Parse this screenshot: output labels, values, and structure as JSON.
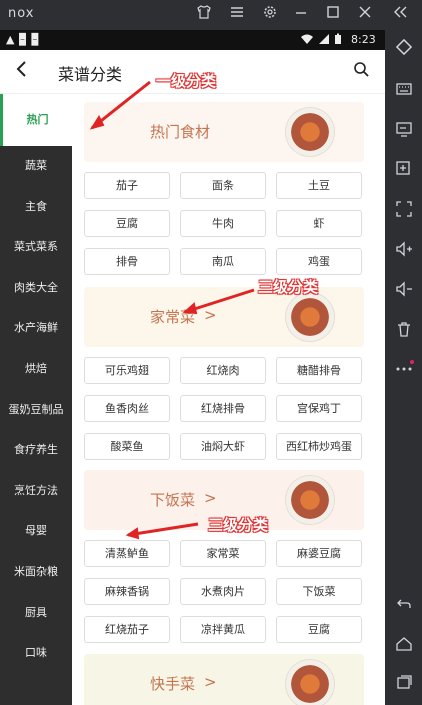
{
  "emulator": {
    "logo": "nox",
    "toolbar_icons": [
      "shirt-icon",
      "menu-icon",
      "gear-icon",
      "minimize-icon",
      "maximize-icon",
      "close-icon",
      "collapse-icon"
    ],
    "side_icons": [
      "diamond-icon",
      "keyboard-icon",
      "screen-icon",
      "add-apk-icon",
      "fullscreen-icon",
      "volume-up-icon",
      "volume-down-icon",
      "trash-icon",
      "more-icon",
      "back-icon",
      "home-icon",
      "recent-apps-icon"
    ]
  },
  "status": {
    "left_text": "▲ 🁢 🁢",
    "time": "8:23"
  },
  "appbar": {
    "title": "菜谱分类",
    "search_icon": "search-icon",
    "back_icon": "back-icon"
  },
  "sidebar": {
    "items": [
      {
        "label": "热门",
        "active": true
      },
      {
        "label": "蔬菜"
      },
      {
        "label": "主食"
      },
      {
        "label": "菜式菜系"
      },
      {
        "label": "肉类大全"
      },
      {
        "label": "水产海鲜"
      },
      {
        "label": "烘焙"
      },
      {
        "label": "蛋奶豆制品"
      },
      {
        "label": "食疗养生"
      },
      {
        "label": "烹饪方法"
      },
      {
        "label": "母婴"
      },
      {
        "label": "米面杂粮"
      },
      {
        "label": "厨具"
      },
      {
        "label": "口味"
      }
    ]
  },
  "sections": [
    {
      "title": "热门食材",
      "arrow": "",
      "color": "#fdf5ef",
      "items": [
        "茄子",
        "面条",
        "土豆",
        "豆腐",
        "牛肉",
        "虾",
        "排骨",
        "南瓜",
        "鸡蛋"
      ]
    },
    {
      "title": "家常菜",
      "arrow": ">",
      "color": "#fcf7ea",
      "items": [
        "可乐鸡翅",
        "红烧肉",
        "糖醋排骨",
        "鱼香肉丝",
        "红烧排骨",
        "宫保鸡丁",
        "酸菜鱼",
        "油焖大虾",
        "西红柿炒鸡蛋"
      ]
    },
    {
      "title": "下饭菜",
      "arrow": ">",
      "color": "#fdf1ec",
      "items": [
        "清蒸鲈鱼",
        "家常菜",
        "麻婆豆腐",
        "麻辣香锅",
        "水煮肉片",
        "下饭菜",
        "红烧茄子",
        "凉拌黄瓜",
        "豆腐"
      ]
    },
    {
      "title": "快手菜",
      "arrow": ">",
      "color": "#f7f6e6",
      "items": []
    }
  ],
  "annotations": {
    "level1": "一级分类",
    "level3_a": "三级分类",
    "level3_b": "三级分类"
  },
  "colors": {
    "accent": "#2aa152",
    "sidebar_bg": "#2e2e2e",
    "banner_text": "#c57450",
    "annotation": "#d33333"
  }
}
